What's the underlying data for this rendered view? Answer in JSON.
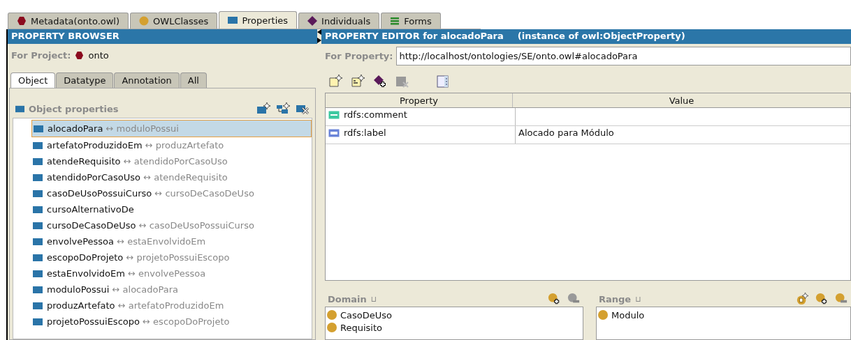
{
  "tabs": [
    {
      "label": "Metadata(onto.owl)",
      "kind": "metadata",
      "selected": false
    },
    {
      "label": "OWLClasses",
      "kind": "class",
      "selected": false
    },
    {
      "label": "Properties",
      "kind": "property",
      "selected": true
    },
    {
      "label": "Individuals",
      "kind": "individual",
      "selected": false
    },
    {
      "label": "Forms",
      "kind": "forms",
      "selected": false
    }
  ],
  "browser": {
    "title": "PROPERTY BROWSER",
    "project_label": "For Project:",
    "project": "onto",
    "subtabs": [
      {
        "label": "Object",
        "selected": true
      },
      {
        "label": "Datatype",
        "selected": false
      },
      {
        "label": "Annotation",
        "selected": false
      },
      {
        "label": "All",
        "selected": false
      }
    ],
    "list_title": "Object properties",
    "items": [
      {
        "name": "alocadoPara",
        "link": "↔",
        "inverse": "moduloPossui",
        "selected": true
      },
      {
        "name": "artefatoProduzidoEm",
        "link": "↔",
        "inverse": "produzArtefato",
        "selected": false
      },
      {
        "name": "atendeRequisito",
        "link": "↔",
        "inverse": "atendidoPorCasoUso",
        "selected": false
      },
      {
        "name": "atendidoPorCasoUso",
        "link": "↔",
        "inverse": "atendeRequisito",
        "selected": false
      },
      {
        "name": "casoDeUsoPossuiCurso",
        "link": "↔",
        "inverse": "cursoDeCasoDeUso",
        "selected": false
      },
      {
        "name": "cursoAlternativoDe",
        "selected": false
      },
      {
        "name": "cursoDeCasoDeUso",
        "link": "↔",
        "inverse": "casoDeUsoPossuiCurso",
        "selected": false
      },
      {
        "name": "envolvePessoa",
        "link": "↔",
        "inverse": "estaEnvolvidoEm",
        "selected": false
      },
      {
        "name": "escopoDoProjeto",
        "link": "↔",
        "inverse": "projetoPossuiEscopo",
        "selected": false
      },
      {
        "name": "estaEnvolvidoEm",
        "link": "↔",
        "inverse": "envolvePessoa",
        "selected": false
      },
      {
        "name": "moduloPossui",
        "link": "↔",
        "inverse": "alocadoPara",
        "selected": false
      },
      {
        "name": "produzArtefato",
        "link": "↔",
        "inverse": "artefatoProduzidoEm",
        "selected": false
      },
      {
        "name": "projetoPossuiEscopo",
        "link": "↔",
        "inverse": "escopoDoProjeto",
        "selected": false
      }
    ]
  },
  "editor": {
    "title": "PROPERTY EDITOR for alocadoPara",
    "subtitle": "(instance of owl:ObjectProperty)",
    "property_label": "For Property:",
    "property_uri": "http://localhost/ontologies/SE/onto.owl#alocadoPara",
    "columns": [
      "Property",
      "Value"
    ],
    "rows": [
      {
        "kind": "comment",
        "property": "rdfs:comment"
      },
      {
        "kind": "label",
        "property": "rdfs:label",
        "value": "Alocado para Módulo"
      }
    ],
    "domain": {
      "title": "Domain",
      "symbol": "⊔",
      "classes": [
        "CasoDeUso",
        "Requisito"
      ]
    },
    "range": {
      "title": "Range",
      "symbol": "⊔",
      "classes": [
        "Modulo"
      ]
    }
  }
}
